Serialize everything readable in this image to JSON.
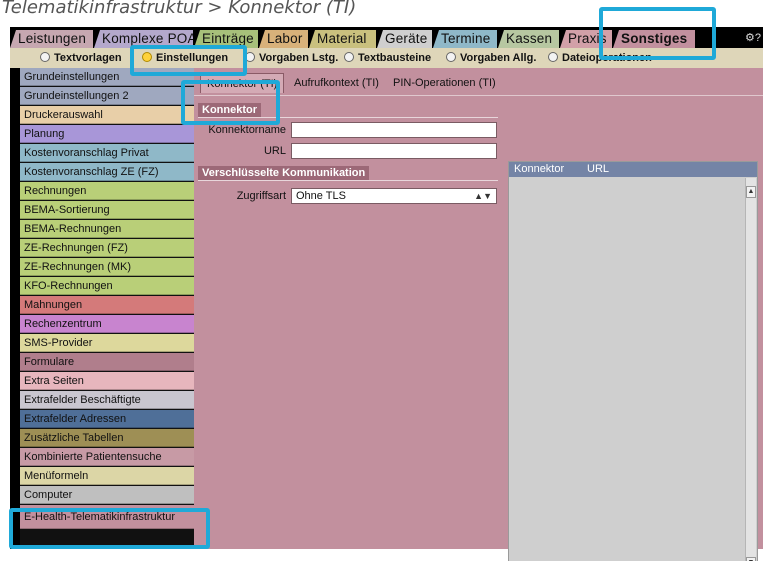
{
  "breadcrumb": "Telematikinfrastruktur > Konnektor (TI)",
  "main_tabs": [
    {
      "label": "Leistungen",
      "color": "#c6a7b0"
    },
    {
      "label": "Komplexe POA",
      "color": "#b4a8cc"
    },
    {
      "label": "Einträge",
      "color": "#a7c07a"
    },
    {
      "label": "Labor",
      "color": "#d8b17a"
    },
    {
      "label": "Material",
      "color": "#c9c07e"
    },
    {
      "label": "Geräte",
      "color": "#cfcfcf"
    },
    {
      "label": "Termine",
      "color": "#8fb8c8"
    },
    {
      "label": "Kassen",
      "color": "#b7c7a1"
    },
    {
      "label": "Praxis",
      "color": "#d2a0a8"
    },
    {
      "label": "Sonstiges",
      "color": "#c2909e"
    }
  ],
  "help_icon": "help-icon",
  "subnav": {
    "items": [
      {
        "label": "Textvorlagen",
        "selected": false
      },
      {
        "label": "Einstellungen",
        "selected": true
      },
      {
        "label": "Vorgaben Lstg.",
        "selected": false
      },
      {
        "label": "Textbausteine",
        "selected": false
      },
      {
        "label": "Vorgaben Allg.",
        "selected": false
      },
      {
        "label": "Dateioperationen",
        "selected": false
      }
    ]
  },
  "sidebar": {
    "items": [
      {
        "label": "Grundeinstellungen",
        "color": "#9fa8bf"
      },
      {
        "label": "Grundeinstellungen 2",
        "color": "#9fa8bf"
      },
      {
        "label": "Druckerauswahl",
        "color": "#e8cfa8"
      },
      {
        "label": "Planung",
        "color": "#a896d8"
      },
      {
        "label": "Kostenvoranschlag Privat",
        "color": "#8fb8c8"
      },
      {
        "label": "Kostenvoranschlag ZE (FZ)",
        "color": "#8fb8c8"
      },
      {
        "label": "Rechnungen",
        "color": "#b9cf78"
      },
      {
        "label": "BEMA-Sortierung",
        "color": "#b9cf78"
      },
      {
        "label": "BEMA-Rechnungen",
        "color": "#b9cf78"
      },
      {
        "label": "ZE-Rechnungen (FZ)",
        "color": "#b9cf78"
      },
      {
        "label": "ZE-Rechnungen (MK)",
        "color": "#b9cf78"
      },
      {
        "label": "KFO-Rechnungen",
        "color": "#b9cf78"
      },
      {
        "label": "Mahnungen",
        "color": "#d47a7a"
      },
      {
        "label": "Rechenzentrum",
        "color": "#c884cf"
      },
      {
        "label": "SMS-Provider",
        "color": "#ddd89c"
      },
      {
        "label": "Formulare",
        "color": "#b07e8c"
      },
      {
        "label": "Extra Seiten",
        "color": "#e7b6bd"
      },
      {
        "label": "Extrafelder Beschäftigte",
        "color": "#c9c6cf"
      },
      {
        "label": "Extrafelder Adressen",
        "color": "#4f6f98"
      },
      {
        "label": "Zusätzliche Tabellen",
        "color": "#9e8f55"
      },
      {
        "label": "Kombinierte Patientensuche",
        "color": "#c79aa5"
      },
      {
        "label": "Menüformeln",
        "color": "#dcd6a6"
      },
      {
        "label": "Computer",
        "color": "#bfbfbf"
      },
      {
        "label": "E-Health-Telematikinfrastruktur",
        "color": "#c2909e"
      }
    ]
  },
  "sub_tabs": [
    {
      "label": "Konnektor (TI)",
      "active": true
    },
    {
      "label": "Aufrufkontext (TI)",
      "active": false
    },
    {
      "label": "PIN-Operationen (TI)",
      "active": false
    }
  ],
  "form": {
    "section1_title": "Konnektor",
    "name_label": "Konnektorname",
    "name_value": "",
    "url_label": "URL",
    "url_value": "",
    "section2_title": "Verschlüsselte Kommunikation",
    "access_label": "Zugriffsart",
    "access_value": "Ohne TLS"
  },
  "list": {
    "columns": [
      "Konnektor",
      "URL"
    ]
  },
  "colors": {
    "highlight": "#1fa9d8",
    "content_bg": "#c2909e"
  }
}
